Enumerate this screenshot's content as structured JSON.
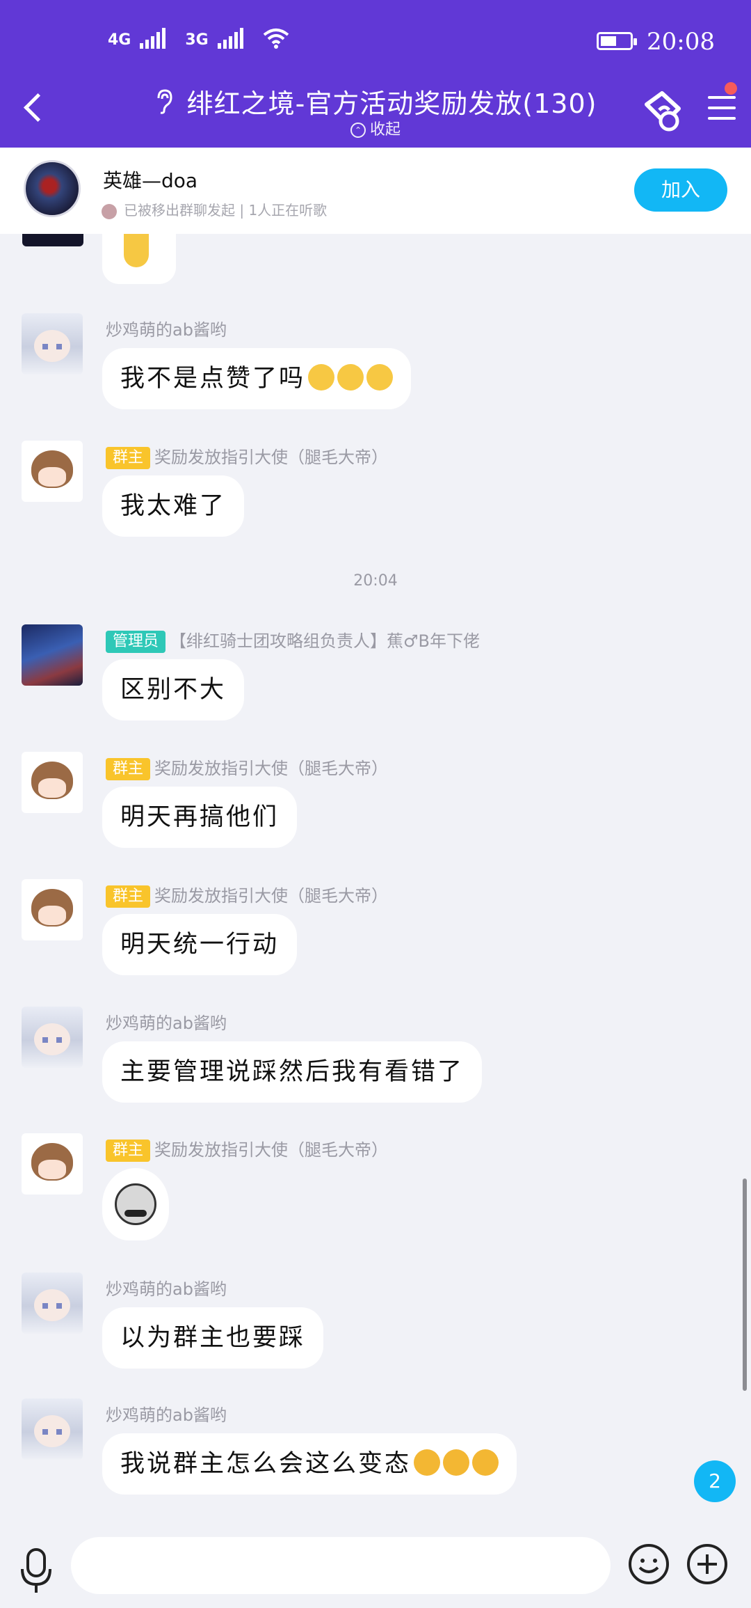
{
  "status": {
    "net1": "4G",
    "net2": "3G",
    "time": "20:08"
  },
  "header": {
    "title": "绯红之境-官方活动奖励发放(130)",
    "collapse_label": "收起"
  },
  "song": {
    "name": "英雄—doa",
    "subtitle": "已被移出群聊发起 | 1人正在听歌",
    "join_label": "加入"
  },
  "messages": [
    {
      "sender": "炒鸡萌的ab酱哟",
      "text": "我不是点赞了吗"
    },
    {
      "tag": "群主",
      "sender": "奖励发放指引大使（腿毛大帝）",
      "text": "我太难了"
    },
    {
      "time": "20:04"
    },
    {
      "tag": "管理员",
      "sender": "【绯红骑士团攻略组负责人】蕉♂B年下佬",
      "text": "区别不大"
    },
    {
      "tag": "群主",
      "sender": "奖励发放指引大使（腿毛大帝）",
      "text": "明天再搞他们"
    },
    {
      "tag": "群主",
      "sender": "奖励发放指引大使（腿毛大帝）",
      "text": "明天统一行动"
    },
    {
      "sender": "炒鸡萌的ab酱哟",
      "text": "主要管理说踩然后我有看错了"
    },
    {
      "tag": "群主",
      "sender": "奖励发放指引大使（腿毛大帝）",
      "text": ""
    },
    {
      "sender": "炒鸡萌的ab酱哟",
      "text": "以为群主也要踩"
    },
    {
      "sender": "炒鸡萌的ab酱哟",
      "text": "我说群主怎么会这么变态"
    }
  ],
  "unread_count": "2",
  "input": {
    "placeholder": ""
  },
  "icons": {
    "back": "chevron-left-icon",
    "ear": "ear-icon",
    "audio": "voice-call-icon",
    "menu": "menu-icon",
    "mic": "microphone-icon",
    "emoji": "emoji-icon",
    "plus": "plus-icon"
  },
  "colors": {
    "header_bg": "#6138d6",
    "join_button": "#12b7f5",
    "owner_tag": "#f9c42b",
    "admin_tag": "#2ec8b7",
    "unread_badge": "#12b7f5",
    "menu_dot": "#f65b5b"
  }
}
